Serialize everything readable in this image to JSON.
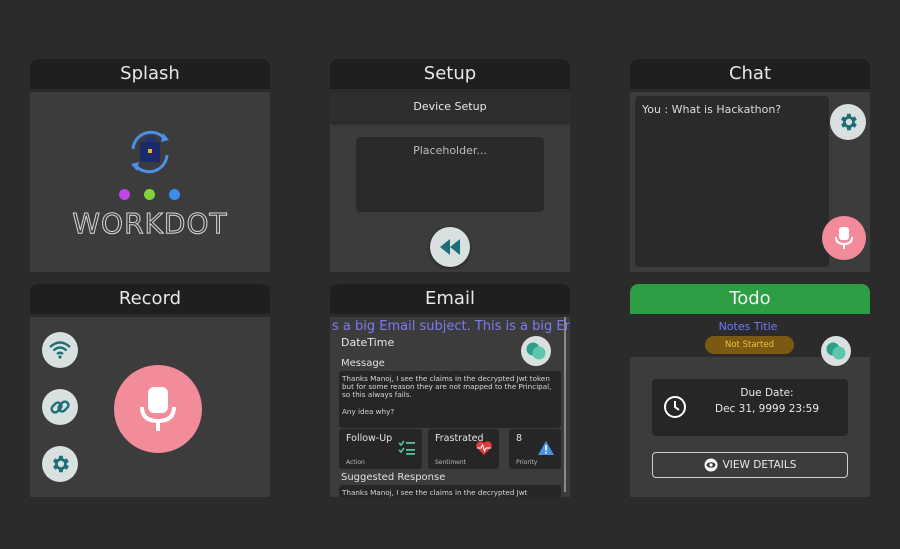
{
  "splash": {
    "title": "Splash",
    "wordmark": "WORKDOT",
    "dot_colors": [
      "#c044e8",
      "#7fd63a",
      "#3c8cf0"
    ]
  },
  "setup": {
    "title": "Setup",
    "header": "Device Setup",
    "placeholder": "Placeholder..."
  },
  "chat": {
    "title": "Chat",
    "message": "You : What is Hackathon?"
  },
  "record": {
    "title": "Record"
  },
  "email": {
    "title": "Email",
    "subject": "s a big Email subject. This is a big Ema",
    "datetime": "DateTime",
    "message_label": "Message",
    "message": "Thanks Manoj, I see the claims in the decrypted Jwt token but for some reason they are not mapped to the Principal, so this always fails.\n\nAny idea why?",
    "cards": [
      {
        "value": "Follow-Up",
        "sub": "Action"
      },
      {
        "value": "Frastrated",
        "sub": "Sentiment"
      },
      {
        "value": "8",
        "sub": "Priority"
      }
    ],
    "response_label": "Suggested Response",
    "response": "Thanks Manoj, I see the claims in the decrypted Jwt"
  },
  "todo": {
    "title": "Todo",
    "notes_title": "Notes Title",
    "status": "Not Started",
    "due_label": "Due Date:",
    "due_value": "Dec 31, 9999 23:59",
    "view_details": "VIEW DETAILS"
  },
  "colors": {
    "accent_teal": "#1c6e77",
    "mic_pink": "#f28b9a",
    "todo_green": "#2e9e44",
    "link_blue": "#6f78ff"
  }
}
